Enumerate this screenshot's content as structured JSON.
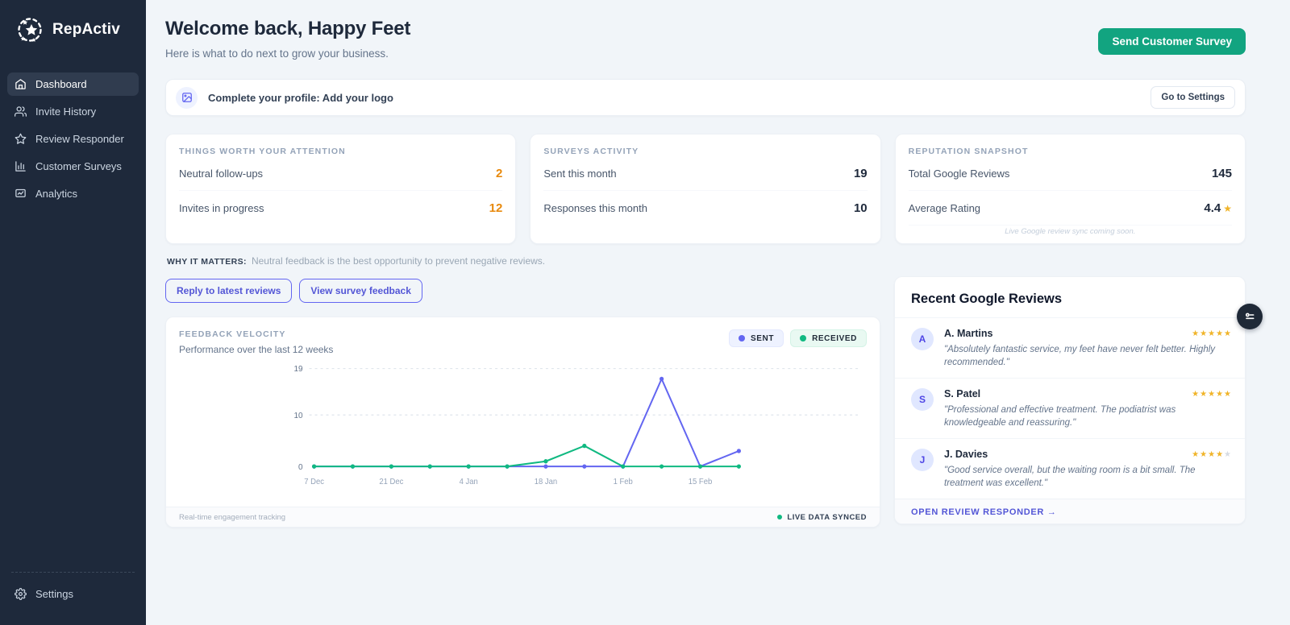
{
  "colors": {
    "accent_green": "#12a480",
    "accent_indigo": "#6366f1",
    "warning_orange": "#e8890c",
    "sent_line": "#6366f1",
    "received_line": "#10b981",
    "star_gold": "#f0b429",
    "sidebar_bg": "#1e293b"
  },
  "sidebar": {
    "brand": "RepActiv",
    "items": [
      {
        "label": "Dashboard",
        "icon": "home-icon",
        "active": true
      },
      {
        "label": "Invite History",
        "icon": "users-icon",
        "active": false
      },
      {
        "label": "Review Responder",
        "icon": "star-icon",
        "active": false
      },
      {
        "label": "Customer Surveys",
        "icon": "bar-chart-icon",
        "active": false
      },
      {
        "label": "Analytics",
        "icon": "presentation-chart-icon",
        "active": false
      }
    ],
    "settings_label": "Settings"
  },
  "header": {
    "title": "Welcome back, Happy Feet",
    "subtitle": "Here is what to do next to grow your business.",
    "cta_label": "Send Customer Survey"
  },
  "profile_banner": {
    "text": "Complete your profile: Add your logo",
    "action_label": "Go to Settings"
  },
  "stat_cards": [
    {
      "title": "THINGS WORTH YOUR ATTENTION",
      "rows": [
        {
          "label": "Neutral follow-ups",
          "value": "2"
        },
        {
          "label": "Invites in progress",
          "value": "12"
        }
      ]
    },
    {
      "title": "SURVEYS ACTIVITY",
      "rows": [
        {
          "label": "Sent this month",
          "value": "19"
        },
        {
          "label": "Responses this month",
          "value": "10"
        }
      ]
    },
    {
      "title": "REPUTATION SNAPSHOT",
      "rows": [
        {
          "label": "Total Google Reviews",
          "value": "145"
        },
        {
          "label": "Average Rating",
          "value": "4.4"
        }
      ],
      "note": "Live Google review sync coming soon."
    }
  ],
  "why_it_matters": {
    "label": "WHY IT MATTERS:",
    "text": "Neutral feedback is the best opportunity to prevent negative reviews."
  },
  "actions": {
    "reply_label": "Reply to latest reviews",
    "feedback_label": "View survey feedback"
  },
  "chart_data": {
    "type": "line",
    "title": "FEEDBACK VELOCITY",
    "subtitle": "Performance over the last 12 weeks",
    "x_tick_labels": [
      "7 Dec",
      "21 Dec",
      "4 Jan",
      "18 Jan",
      "1 Feb",
      "15 Feb"
    ],
    "points_per_label": 2,
    "y_ticks": [
      0,
      10,
      19
    ],
    "ylim": [
      0,
      19
    ],
    "grid": true,
    "legend_position": "top-right",
    "series": [
      {
        "name": "SENT",
        "color": "#6366f1",
        "values": [
          0,
          0,
          0,
          0,
          0,
          0,
          0,
          0,
          0,
          17,
          0,
          3
        ]
      },
      {
        "name": "RECEIVED",
        "color": "#10b981",
        "values": [
          0,
          0,
          0,
          0,
          0,
          0,
          1,
          4,
          0,
          0,
          0,
          0
        ]
      }
    ],
    "footer_left": "Real-time engagement tracking",
    "footer_right": "LIVE DATA SYNCED"
  },
  "reviews_card": {
    "title": "Recent Google Reviews",
    "reviews": [
      {
        "initial": "A",
        "name": "A. Martins",
        "stars": 5,
        "quote": "\"Absolutely fantastic service, my feet have never felt better. Highly recommended.\""
      },
      {
        "initial": "S",
        "name": "S. Patel",
        "stars": 5,
        "quote": "\"Professional and effective treatment. The podiatrist was knowledgeable and reassuring.\""
      },
      {
        "initial": "J",
        "name": "J. Davies",
        "stars": 4,
        "quote": "\"Good service overall, but the waiting room is a bit small. The treatment was excellent.\""
      }
    ],
    "footer_link": "OPEN REVIEW RESPONDER →"
  }
}
